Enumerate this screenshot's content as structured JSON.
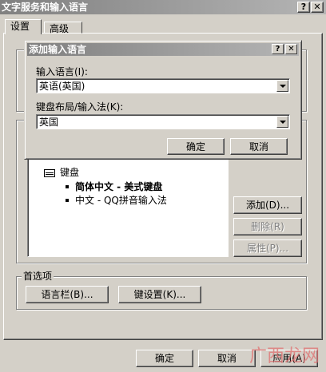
{
  "window": {
    "title": "文字服务和输入语言",
    "help_glyph": "?",
    "close_glyph": "✕"
  },
  "tabs": [
    {
      "label": "设置"
    },
    {
      "label": "高级"
    }
  ],
  "installed": {
    "tree_category": "键盘",
    "items": [
      {
        "label": "简体中文 - 美式键盘"
      },
      {
        "label": "中文 - QQ拼音输入法"
      }
    ],
    "buttons": {
      "add": "添加(D)...",
      "remove": "删除(R)",
      "properties": "属性(P)..."
    }
  },
  "preferences": {
    "title": "首选项",
    "language_bar": "语言栏(B)...",
    "key_settings": "键设置(K)..."
  },
  "footer": {
    "ok": "确定",
    "cancel": "取消",
    "apply": "应用(A)"
  },
  "add_dialog": {
    "title": "添加输入语言",
    "help_glyph": "?",
    "close_glyph": "✕",
    "language_label": "输入语言(I):",
    "language_value": "英语(英国)",
    "layout_label": "键盘布局/输入法(K):",
    "layout_value": "英国",
    "ok": "确定",
    "cancel": "取消"
  },
  "watermark": {
    "text": "广西龙网"
  }
}
